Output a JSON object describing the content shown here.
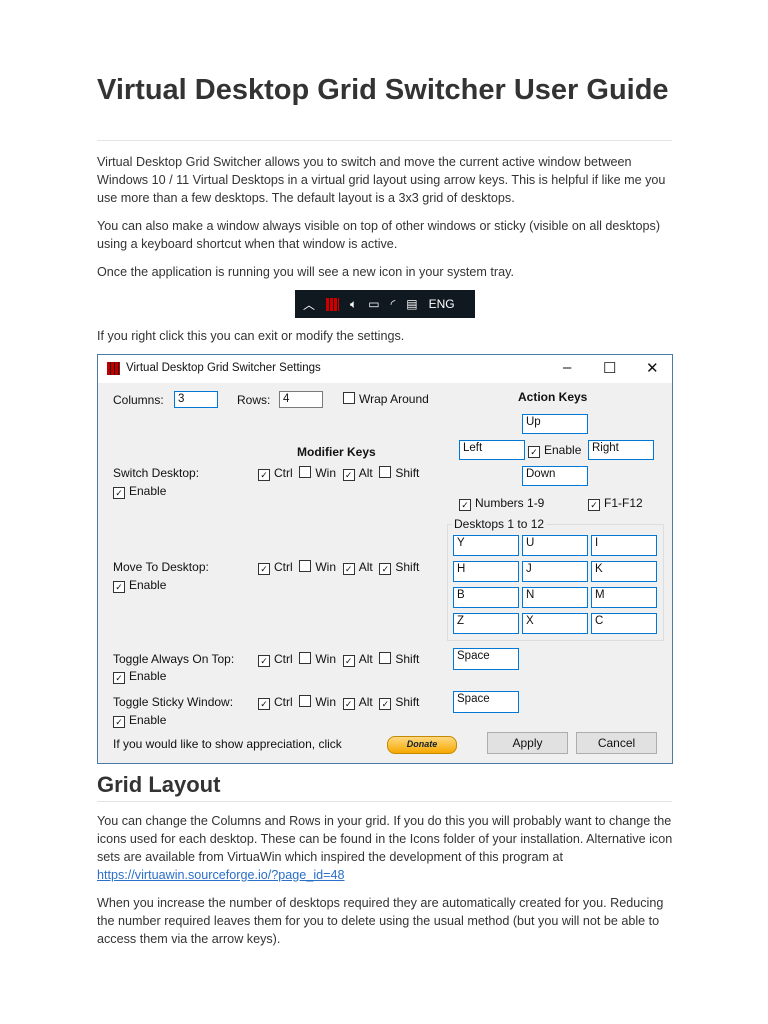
{
  "title": "Virtual Desktop Grid Switcher User Guide",
  "paragraphs": [
    "Virtual Desktop Grid Switcher allows you to switch and move the current active window between Windows 10 / 11 Virtual Desktops in a virtual grid layout using arrow keys. This is helpful if like me you use more than a few desktops. The default layout is a 3x3 grid of desktops.",
    "You can also make a window always visible on top of other windows or sticky (visible on all desktops) using a keyboard shortcut when that window is active.",
    "Once the application is running you will see a new icon in your system tray.",
    "If you right click this you can exit or modify the settings."
  ],
  "tray": {
    "language": "ENG"
  },
  "dialog": {
    "title": "Virtual Desktop Grid Switcher Settings",
    "columns_label": "Columns:",
    "columns_value": "3",
    "rows_label": "Rows:",
    "rows_value": "4",
    "wrap_label": "Wrap Around",
    "action_keys": "Action Keys",
    "up": "Up",
    "left": "Left",
    "right": "Right",
    "down": "Down",
    "enable": "Enable",
    "numbers": "Numbers 1-9",
    "fkeys": "F1-F12",
    "modifier_keys": "Modifier Keys",
    "ctrl": "Ctrl",
    "win": "Win",
    "alt": "Alt",
    "shift": "Shift",
    "switch_desktop": "Switch Desktop:",
    "move_to_desktop": "Move To Desktop:",
    "toggle_on_top": "Toggle Always On Top:",
    "toggle_sticky": "Toggle Sticky Window:",
    "desktops_group": "Desktops 1 to 12",
    "desktop_keys": [
      "Y",
      "U",
      "I",
      "H",
      "J",
      "K",
      "B",
      "N",
      "M",
      "Z",
      "X",
      "C"
    ],
    "on_top_key": "Space",
    "sticky_key": "Space",
    "appreciation": "If you would like to show appreciation, click",
    "donate": "Donate",
    "apply": "Apply",
    "cancel": "Cancel"
  },
  "section2": {
    "heading": "Grid Layout",
    "p1": "You can change the Columns and Rows in your grid. If you do this you will probably want to change the icons used for each desktop. These can be found in the Icons folder of your installation. Alternative icon sets are available from VirtuaWin which inspired the development of this program at",
    "link": "https://virtuawin.sourceforge.io/?page_id=48",
    "p2": "When you increase the number of desktops required they are automatically created for you. Reducing the number required leaves them for you to delete using the usual method (but you will not be able to access them via the arrow keys)."
  }
}
